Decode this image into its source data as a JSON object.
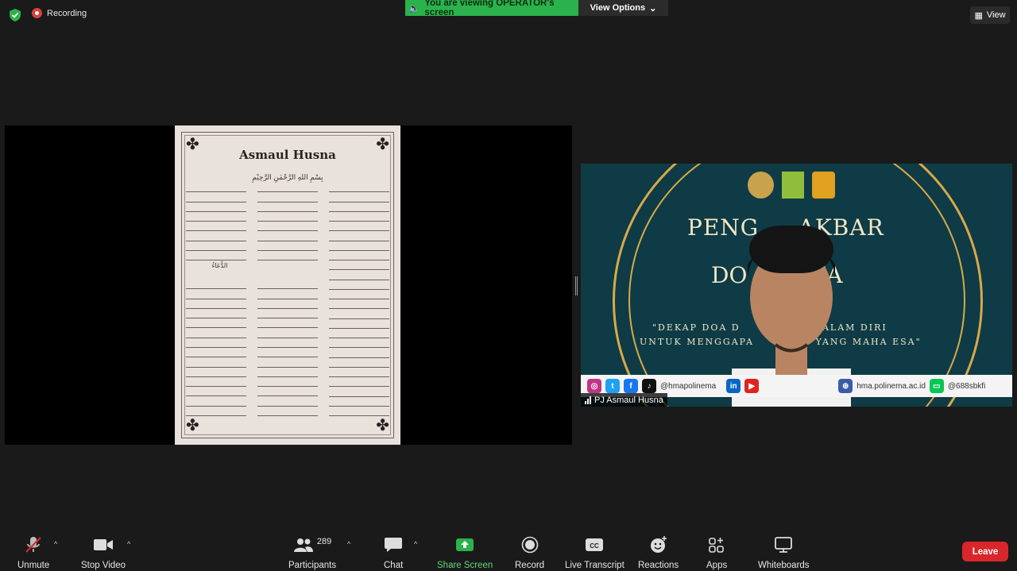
{
  "topbar": {
    "recording_label": "Recording",
    "viewing_label": "You are viewing OPERATOR's screen",
    "view_options_label": "View Options",
    "view_label": "View"
  },
  "shared_doc": {
    "title": "Asmaul Husna",
    "bismillah": "بِسْمِ اللهِ الرَّحْمٰنِ الرَّحِيْمِ",
    "section_label": "الدُّعَاءُ"
  },
  "video": {
    "banner_line1": "PENG     AKBAR",
    "banner_line2": "DO        MA",
    "tagline1": "\"DEKAP DOA D           IAR DALAM DIRI",
    "tagline2": "UNTUK MENGGAPA           N YANG MAHA ESA\"",
    "social_handle": "@hmapolinema",
    "website": "hma.polinema.ac.id",
    "line_id": "@688sbkfi",
    "participant_name": "PJ Asmaul Husna"
  },
  "toolbar": {
    "unmute": "Unmute",
    "stop_video": "Stop Video",
    "participants": "Participants",
    "participants_count": "289",
    "chat": "Chat",
    "share_screen": "Share Screen",
    "record": "Record",
    "live_transcript": "Live Transcript",
    "reactions": "Reactions",
    "apps": "Apps",
    "whiteboards": "Whiteboards",
    "leave": "Leave"
  },
  "colors": {
    "share_green": "#2bb24c",
    "leave_red": "#d8262b",
    "video_bg": "#0e3b45",
    "gold": "#d8a94a"
  }
}
